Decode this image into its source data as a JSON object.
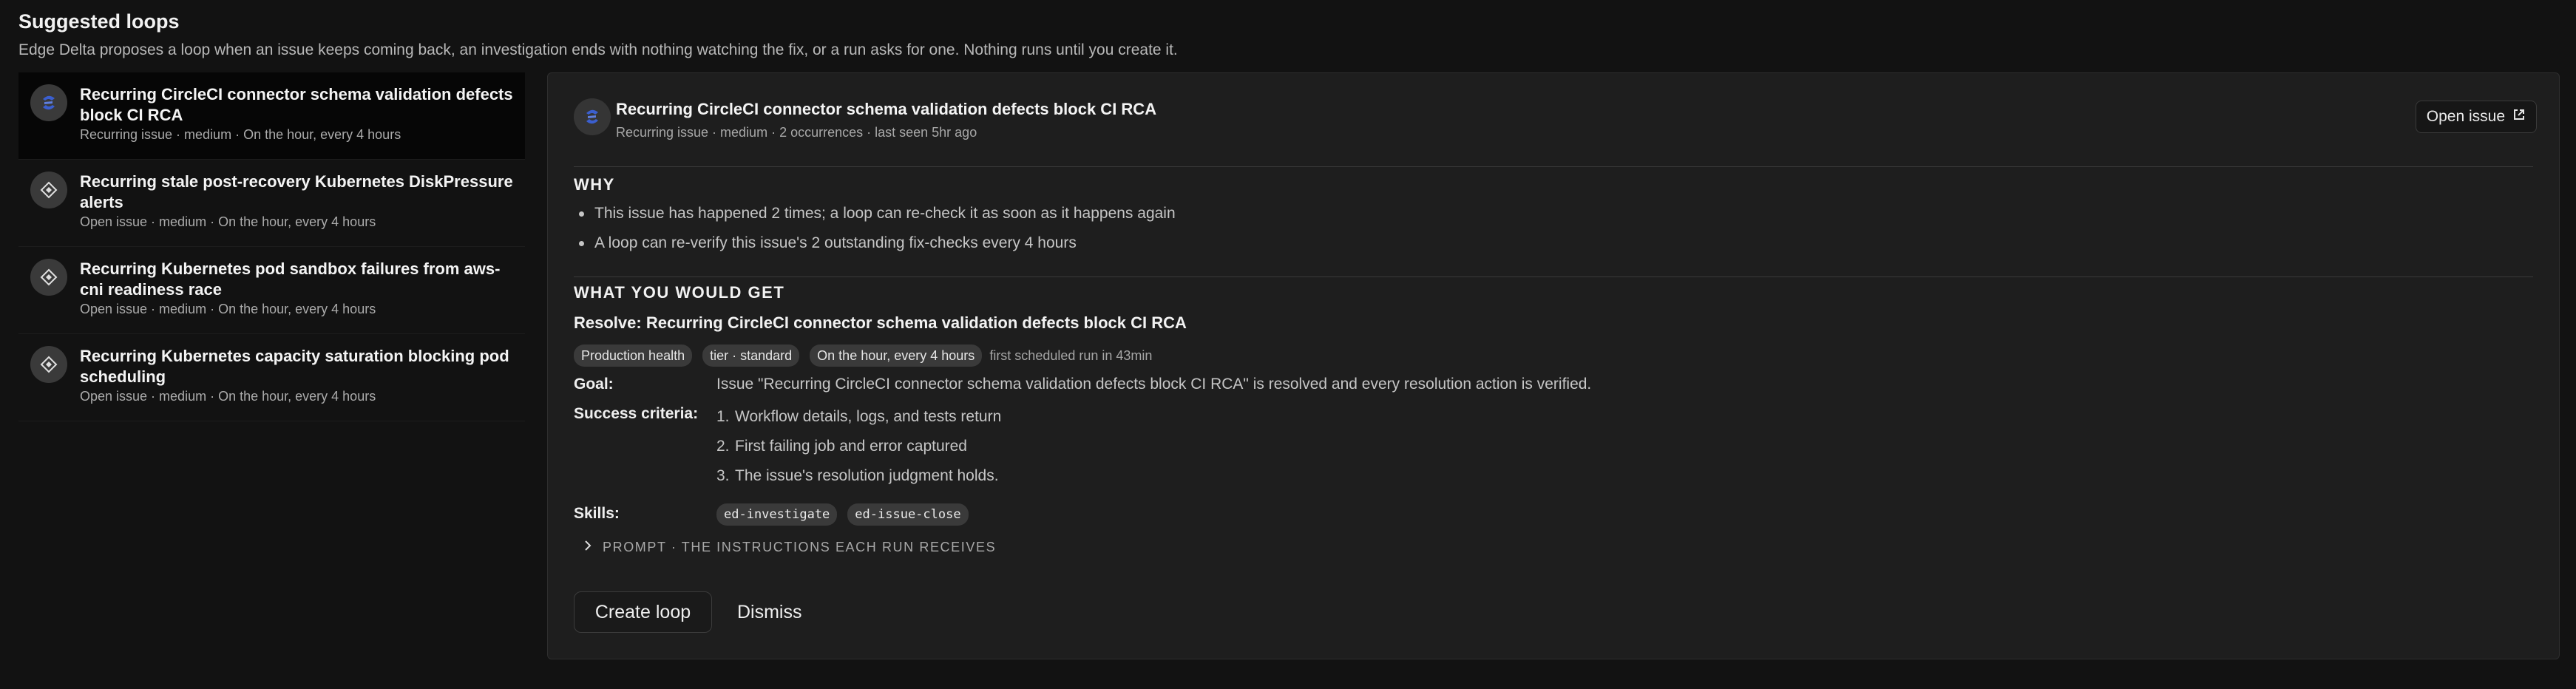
{
  "page": {
    "title": "Suggested loops",
    "subtitle": "Edge Delta proposes a loop when an issue keeps coming back, an investigation ends with nothing watching the fix, or a run asks for one. Nothing runs until you create it."
  },
  "suggestions": [
    {
      "title": "Recurring CircleCI connector schema validation defects block CI RCA",
      "meta": "Recurring issue · medium · On the hour, every 4 hours",
      "icon": "circleci-icon",
      "selected": true
    },
    {
      "title": "Recurring stale post-recovery Kubernetes DiskPressure alerts",
      "meta": "Open issue · medium · On the hour, every 4 hours",
      "icon": "issue-diamond-icon",
      "selected": false
    },
    {
      "title": "Recurring Kubernetes pod sandbox failures from aws-cni readiness race",
      "meta": "Open issue · medium · On the hour, every 4 hours",
      "icon": "issue-diamond-icon",
      "selected": false
    },
    {
      "title": "Recurring Kubernetes capacity saturation blocking pod scheduling",
      "meta": "Open issue · medium · On the hour, every 4 hours",
      "icon": "issue-diamond-icon",
      "selected": false
    }
  ],
  "detail": {
    "title": "Recurring CircleCI connector schema validation defects block CI RCA",
    "meta": "Recurring issue · medium · 2 occurrences · last seen 5hr ago",
    "open_issue_label": "Open issue",
    "why_heading": "WHY",
    "why": [
      "This issue has happened 2 times; a loop can re-check it as soon as it happens again",
      "A loop can re-verify this issue's 2 outstanding fix-checks every 4 hours"
    ],
    "get_heading": "WHAT YOU WOULD GET",
    "resolve": "Resolve: Recurring CircleCI connector schema validation defects block CI RCA",
    "chips": [
      "Production health",
      "tier · standard",
      "On the hour, every 4 hours"
    ],
    "chip_note": "first scheduled run in 43min",
    "goal_label": "Goal:",
    "goal": "Issue \"Recurring CircleCI connector schema validation defects block CI RCA\" is resolved and every resolution action is verified.",
    "criteria_label": "Success criteria:",
    "criteria_numbers": [
      "1.",
      "2.",
      "3."
    ],
    "criteria": [
      "Workflow details, logs, and tests return",
      "First failing job and error captured",
      "The issue's resolution judgment holds."
    ],
    "skills_label": "Skills:",
    "skills": [
      "ed-investigate",
      "ed-issue-close"
    ],
    "prompt_label": "PROMPT · THE INSTRUCTIONS EACH RUN RECEIVES",
    "create_label": "Create loop",
    "dismiss_label": "Dismiss"
  },
  "colors": {
    "background": "#121212",
    "card": "#1e1e1e",
    "selected_item": "#060606",
    "chip": "#3a3a3a",
    "circleci_blue": "#3b5fcf"
  }
}
